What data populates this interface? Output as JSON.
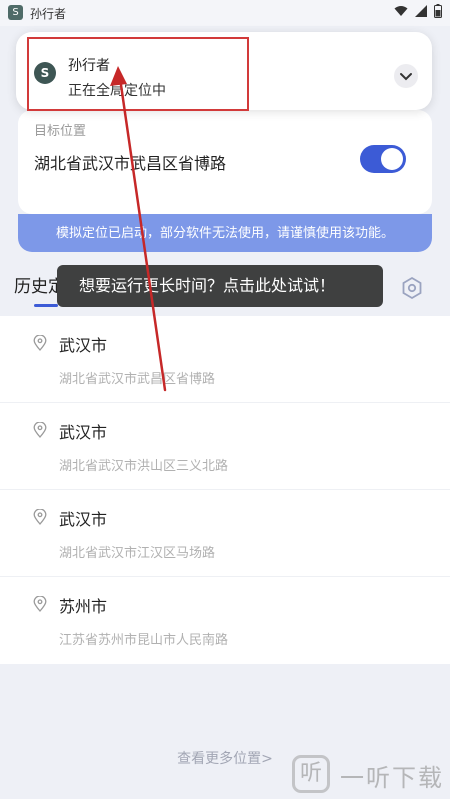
{
  "status_bar": {
    "app_title": "孙行者",
    "app_icon_glyph": "S",
    "icons": [
      "wifi-icon",
      "signal-icon",
      "battery-icon"
    ]
  },
  "notification": {
    "title": "孙行者",
    "text": "正在全局定位中",
    "icon_glyph": "S",
    "expand_icon": "chevron-down-icon"
  },
  "target": {
    "label": "目标位置",
    "address": "湖北省武汉市武昌区省博路",
    "toggle_on": true
  },
  "warning": "模拟定位已启动，部分软件无法使用，请谨慎使用该功能。",
  "tabs": {
    "history_label": "历史定位",
    "settings_icon": "hexagon-settings-icon"
  },
  "tooltip": "想要运行更长时间？点击此处试试！",
  "history": [
    {
      "city": "武汉市",
      "address": "湖北省武汉市武昌区省博路"
    },
    {
      "city": "武汉市",
      "address": "湖北省武汉市洪山区三义北路"
    },
    {
      "city": "武汉市",
      "address": "湖北省武汉市江汉区马场路"
    },
    {
      "city": "苏州市",
      "address": "江苏省苏州市昆山市人民南路"
    }
  ],
  "more_link": "查看更多位置>",
  "watermark": {
    "glyph": "听",
    "text": "一听下载"
  },
  "colors": {
    "accent": "#3c5bd6",
    "warning_bar": "#7d98e8",
    "annotation": "#d23a3a",
    "tooltip_bg": "#3f4040"
  }
}
